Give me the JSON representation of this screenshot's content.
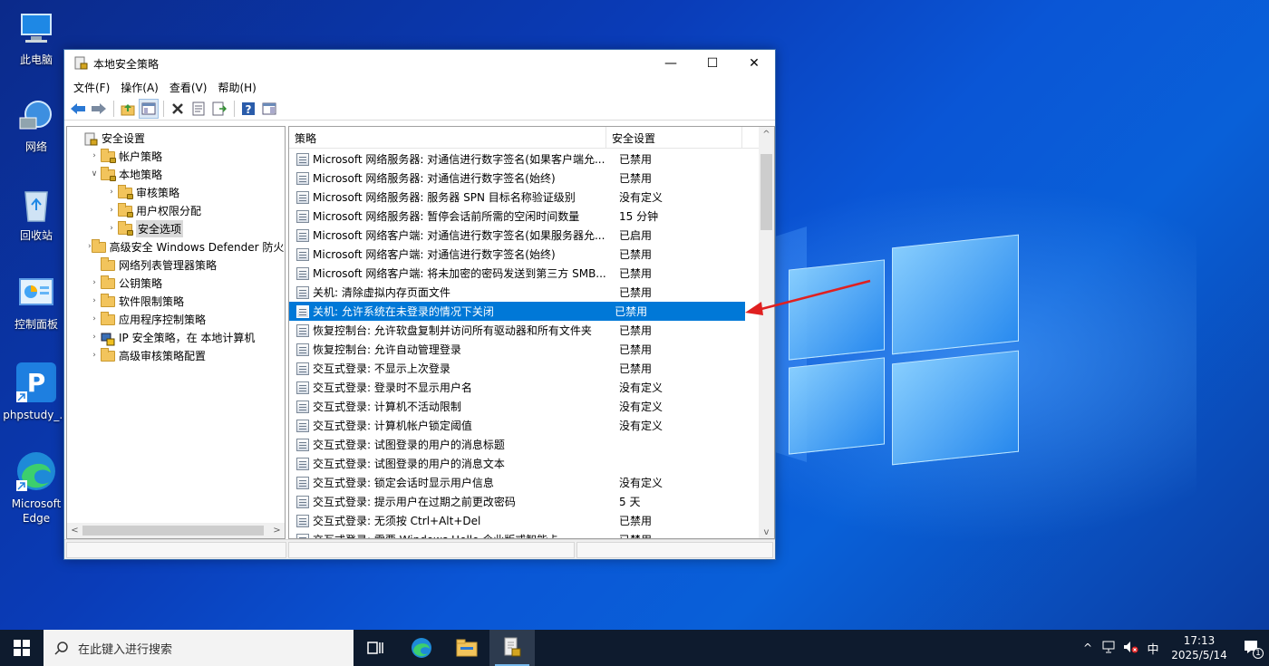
{
  "desktop": {
    "icons": [
      {
        "label": "此电脑"
      },
      {
        "label": "网络"
      },
      {
        "label": "回收站"
      },
      {
        "label": "控制面板"
      },
      {
        "label": "phpstudy_..."
      },
      {
        "label": "Microsoft Edge"
      }
    ]
  },
  "window": {
    "title": "本地安全策略",
    "controls": {
      "minimize": "—",
      "maximize": "☐",
      "close": "✕"
    },
    "menu": [
      "文件(F)",
      "操作(A)",
      "查看(V)",
      "帮助(H)"
    ],
    "tree": [
      {
        "label": "安全设置",
        "level": 0,
        "expander": "",
        "icon": "settings"
      },
      {
        "label": "帐户策略",
        "level": 1,
        "expander": ">",
        "icon": "folder-lock"
      },
      {
        "label": "本地策略",
        "level": 1,
        "expander": "v",
        "icon": "folder-lock"
      },
      {
        "label": "审核策略",
        "level": 2,
        "expander": ">",
        "icon": "folder-lock"
      },
      {
        "label": "用户权限分配",
        "level": 2,
        "expander": ">",
        "icon": "folder-lock"
      },
      {
        "label": "安全选项",
        "level": 2,
        "expander": ">",
        "icon": "folder-lock",
        "selected": true
      },
      {
        "label": "高级安全 Windows Defender 防火墙",
        "level": 1,
        "expander": ">",
        "icon": "folder"
      },
      {
        "label": "网络列表管理器策略",
        "level": 1,
        "expander": "",
        "icon": "folder"
      },
      {
        "label": "公钥策略",
        "level": 1,
        "expander": ">",
        "icon": "folder"
      },
      {
        "label": "软件限制策略",
        "level": 1,
        "expander": ">",
        "icon": "folder"
      },
      {
        "label": "应用程序控制策略",
        "level": 1,
        "expander": ">",
        "icon": "folder"
      },
      {
        "label": "IP 安全策略，在 本地计算机",
        "level": 1,
        "expander": ">",
        "icon": "ipsec"
      },
      {
        "label": "高级审核策略配置",
        "level": 1,
        "expander": ">",
        "icon": "folder"
      }
    ],
    "list": {
      "columns": [
        "策略",
        "安全设置"
      ],
      "rows": [
        {
          "policy": "Microsoft 网络服务器: 对通信进行数字签名(如果客户端允...",
          "setting": "已禁用"
        },
        {
          "policy": "Microsoft 网络服务器: 对通信进行数字签名(始终)",
          "setting": "已禁用"
        },
        {
          "policy": "Microsoft 网络服务器: 服务器 SPN 目标名称验证级别",
          "setting": "没有定义"
        },
        {
          "policy": "Microsoft 网络服务器: 暂停会话前所需的空闲时间数量",
          "setting": "15 分钟"
        },
        {
          "policy": "Microsoft 网络客户端: 对通信进行数字签名(如果服务器允...",
          "setting": "已启用"
        },
        {
          "policy": "Microsoft 网络客户端: 对通信进行数字签名(始终)",
          "setting": "已禁用"
        },
        {
          "policy": "Microsoft 网络客户端: 将未加密的密码发送到第三方 SMB...",
          "setting": "已禁用"
        },
        {
          "policy": "关机: 清除虚拟内存页面文件",
          "setting": "已禁用"
        },
        {
          "policy": "关机: 允许系统在未登录的情况下关闭",
          "setting": "已禁用",
          "selected": true
        },
        {
          "policy": "恢复控制台: 允许软盘复制并访问所有驱动器和所有文件夹",
          "setting": "已禁用"
        },
        {
          "policy": "恢复控制台: 允许自动管理登录",
          "setting": "已禁用"
        },
        {
          "policy": "交互式登录: 不显示上次登录",
          "setting": "已禁用"
        },
        {
          "policy": "交互式登录: 登录时不显示用户名",
          "setting": "没有定义"
        },
        {
          "policy": "交互式登录: 计算机不活动限制",
          "setting": "没有定义"
        },
        {
          "policy": "交互式登录: 计算机帐户锁定阈值",
          "setting": "没有定义"
        },
        {
          "policy": "交互式登录: 试图登录的用户的消息标题",
          "setting": ""
        },
        {
          "policy": "交互式登录: 试图登录的用户的消息文本",
          "setting": ""
        },
        {
          "policy": "交互式登录: 锁定会话时显示用户信息",
          "setting": "没有定义"
        },
        {
          "policy": "交互式登录: 提示用户在过期之前更改密码",
          "setting": "5 天"
        },
        {
          "policy": "交互式登录: 无须按 Ctrl+Alt+Del",
          "setting": "已禁用"
        },
        {
          "policy": "交互式登录: 需要 Windows Hello 企业版或智能卡",
          "setting": "已禁用"
        }
      ]
    }
  },
  "taskbar": {
    "search_placeholder": "在此键入进行搜索",
    "tray": {
      "ime": "中",
      "time": "17:13",
      "date": "2025/5/14",
      "notification_count": "1"
    }
  },
  "colors": {
    "selection": "#0078d7",
    "annotation_arrow": "#e02020",
    "taskbar": "#0e1b2e"
  }
}
